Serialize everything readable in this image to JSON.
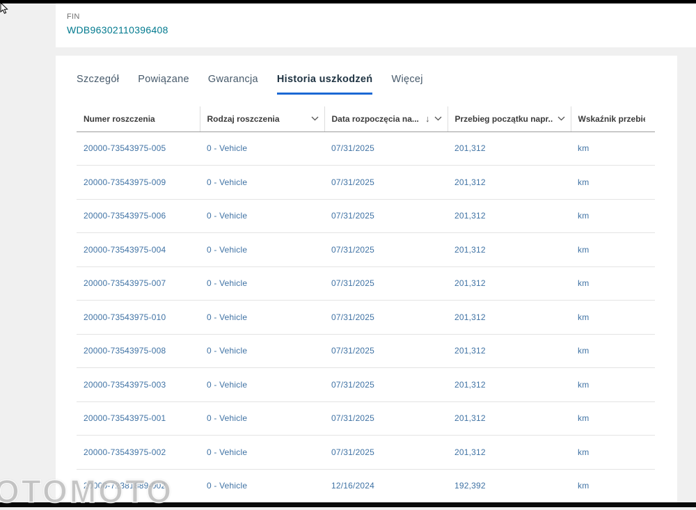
{
  "header": {
    "fin_label": "FIN",
    "fin_value": "WDB96302110396408"
  },
  "tabs": {
    "items": [
      {
        "label": "Szczegół",
        "active": false
      },
      {
        "label": "Powiązane",
        "active": false
      },
      {
        "label": "Gwarancja",
        "active": false
      },
      {
        "label": "Historia uszkodzeń",
        "active": true
      },
      {
        "label": "Więcej",
        "active": false
      }
    ]
  },
  "table": {
    "columns": [
      {
        "label": "Numer roszczenia",
        "menu": false,
        "sorted": false
      },
      {
        "label": "Rodzaj roszczenia",
        "menu": true,
        "sorted": false
      },
      {
        "label": "Data rozpoczęcia na...",
        "menu": true,
        "sorted": "desc"
      },
      {
        "label": "Przebieg początku napr...",
        "menu": true,
        "sorted": false
      },
      {
        "label": "Wskaźnik przebiegu",
        "menu": false,
        "sorted": false
      }
    ],
    "rows": [
      {
        "claim_number": "20000-73543975-005",
        "claim_type": "0 - Vehicle",
        "start_date": "07/31/2025",
        "mileage": "201,312",
        "unit": "km"
      },
      {
        "claim_number": "20000-73543975-009",
        "claim_type": "0 - Vehicle",
        "start_date": "07/31/2025",
        "mileage": "201,312",
        "unit": "km"
      },
      {
        "claim_number": "20000-73543975-006",
        "claim_type": "0 - Vehicle",
        "start_date": "07/31/2025",
        "mileage": "201,312",
        "unit": "km"
      },
      {
        "claim_number": "20000-73543975-004",
        "claim_type": "0 - Vehicle",
        "start_date": "07/31/2025",
        "mileage": "201,312",
        "unit": "km"
      },
      {
        "claim_number": "20000-73543975-007",
        "claim_type": "0 - Vehicle",
        "start_date": "07/31/2025",
        "mileage": "201,312",
        "unit": "km"
      },
      {
        "claim_number": "20000-73543975-010",
        "claim_type": "0 - Vehicle",
        "start_date": "07/31/2025",
        "mileage": "201,312",
        "unit": "km"
      },
      {
        "claim_number": "20000-73543975-008",
        "claim_type": "0 - Vehicle",
        "start_date": "07/31/2025",
        "mileage": "201,312",
        "unit": "km"
      },
      {
        "claim_number": "20000-73543975-003",
        "claim_type": "0 - Vehicle",
        "start_date": "07/31/2025",
        "mileage": "201,312",
        "unit": "km"
      },
      {
        "claim_number": "20000-73543975-001",
        "claim_type": "0 - Vehicle",
        "start_date": "07/31/2025",
        "mileage": "201,312",
        "unit": "km"
      },
      {
        "claim_number": "20000-73543975-002",
        "claim_type": "0 - Vehicle",
        "start_date": "07/31/2025",
        "mileage": "201,312",
        "unit": "km"
      },
      {
        "claim_number": "20000-72381889-002",
        "claim_type": "0 - Vehicle",
        "start_date": "12/16/2024",
        "mileage": "192,392",
        "unit": "km"
      }
    ]
  },
  "watermark": "OTOMOTO",
  "colors": {
    "accent": "#1c69d4",
    "link": "#3f72a4",
    "fin": "#00798e"
  }
}
